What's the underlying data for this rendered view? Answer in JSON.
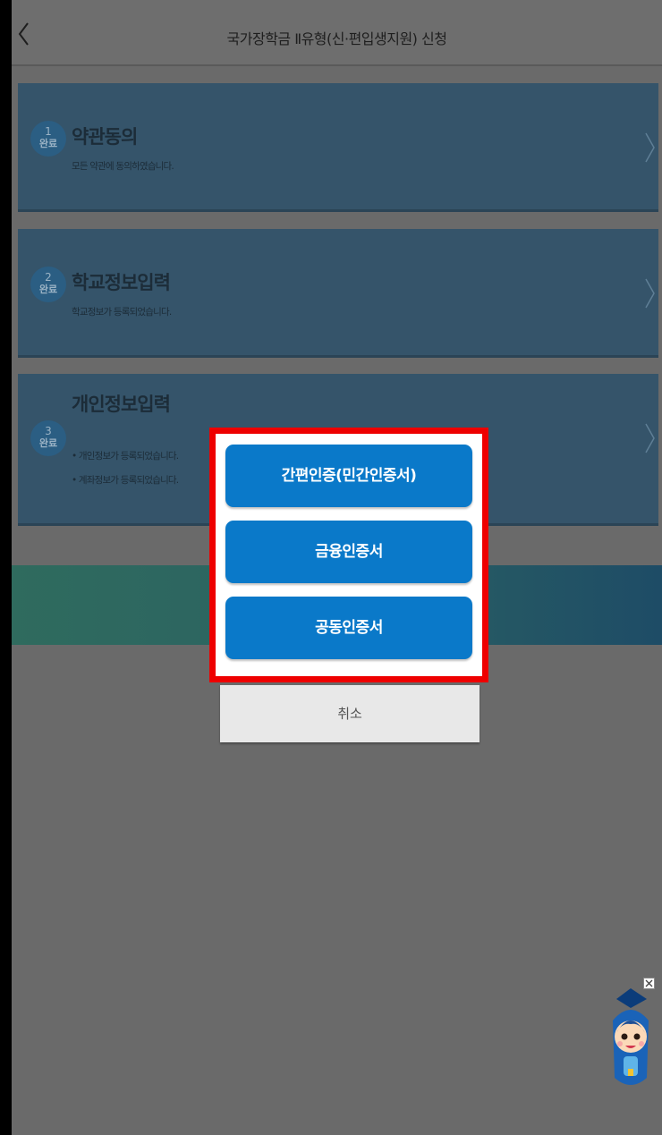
{
  "header": {
    "title": "국가장학금 Ⅱ유형(신·편입생지원) 신청",
    "back_icon": "chevron-left-icon"
  },
  "steps": [
    {
      "num": "1",
      "status": "완료",
      "title": "약관동의",
      "descs": [
        "모든 약관에 동의하였습니다."
      ]
    },
    {
      "num": "2",
      "status": "완료",
      "title": "학교정보입력",
      "descs": [
        "학교정보가 등록되었습니다."
      ]
    },
    {
      "num": "3",
      "status": "완료",
      "title": "개인정보입력",
      "descs": [
        "• 개인정보가 등록되었습니다.",
        "• 계좌정보가 등록되었습니다."
      ]
    }
  ],
  "modal": {
    "options": [
      "간편인증(민간인증서)",
      "금융인증서",
      "공동인증서"
    ],
    "cancel": "취소"
  },
  "colors": {
    "primary_button": "#0a79c9",
    "highlight_border": "#ee0000",
    "step_card": "#35546a"
  },
  "mascot": {
    "icon": "mascot-character-icon",
    "close_icon": "close-icon"
  }
}
